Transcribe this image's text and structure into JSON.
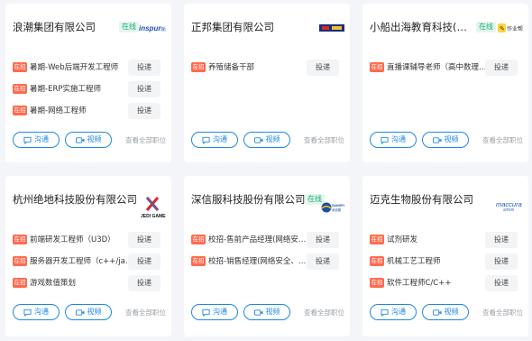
{
  "ui": {
    "online": "在线",
    "hot_tag": "在招",
    "apply": "投递",
    "chat": "沟通",
    "video": "视频",
    "all_positions": "查看全部职位"
  },
  "companies": [
    {
      "name": "浪潮集团有限公司",
      "online": true,
      "logo": "inspur",
      "jobs": [
        "暑期-Web后端开发工程师",
        "暑期-ERP实施工程师",
        "暑期-网络工程师"
      ]
    },
    {
      "name": "正邦集团有限公司",
      "online": false,
      "logo": "zhengbang",
      "jobs": [
        "养殖储备干部"
      ]
    },
    {
      "name": "小船出海教育科技(北京)有...",
      "online": true,
      "logo": "作业帮",
      "jobs": [
        "直播课辅导老师（高中数理化..."
      ]
    },
    {
      "name": "杭州绝地科技股份有限公司",
      "online": false,
      "logo": "JEDI GAMES",
      "jobs": [
        "前端研发工程师（U3D）",
        "服务器开发工程师（c++/java...",
        "游戏数值策划"
      ]
    },
    {
      "name": "深信服科技股份有限公司",
      "online": true,
      "logo": "SANGFOR",
      "jobs": [
        "校招-售前产品经理(网络安全...",
        "校招-销售经理(网络安全、云..."
      ]
    },
    {
      "name": "迈克生物股份有限公司",
      "online": false,
      "logo": "maccura",
      "jobs": [
        "试剂研发",
        "机械工艺工程师",
        "软件工程师C/C++"
      ]
    }
  ]
}
